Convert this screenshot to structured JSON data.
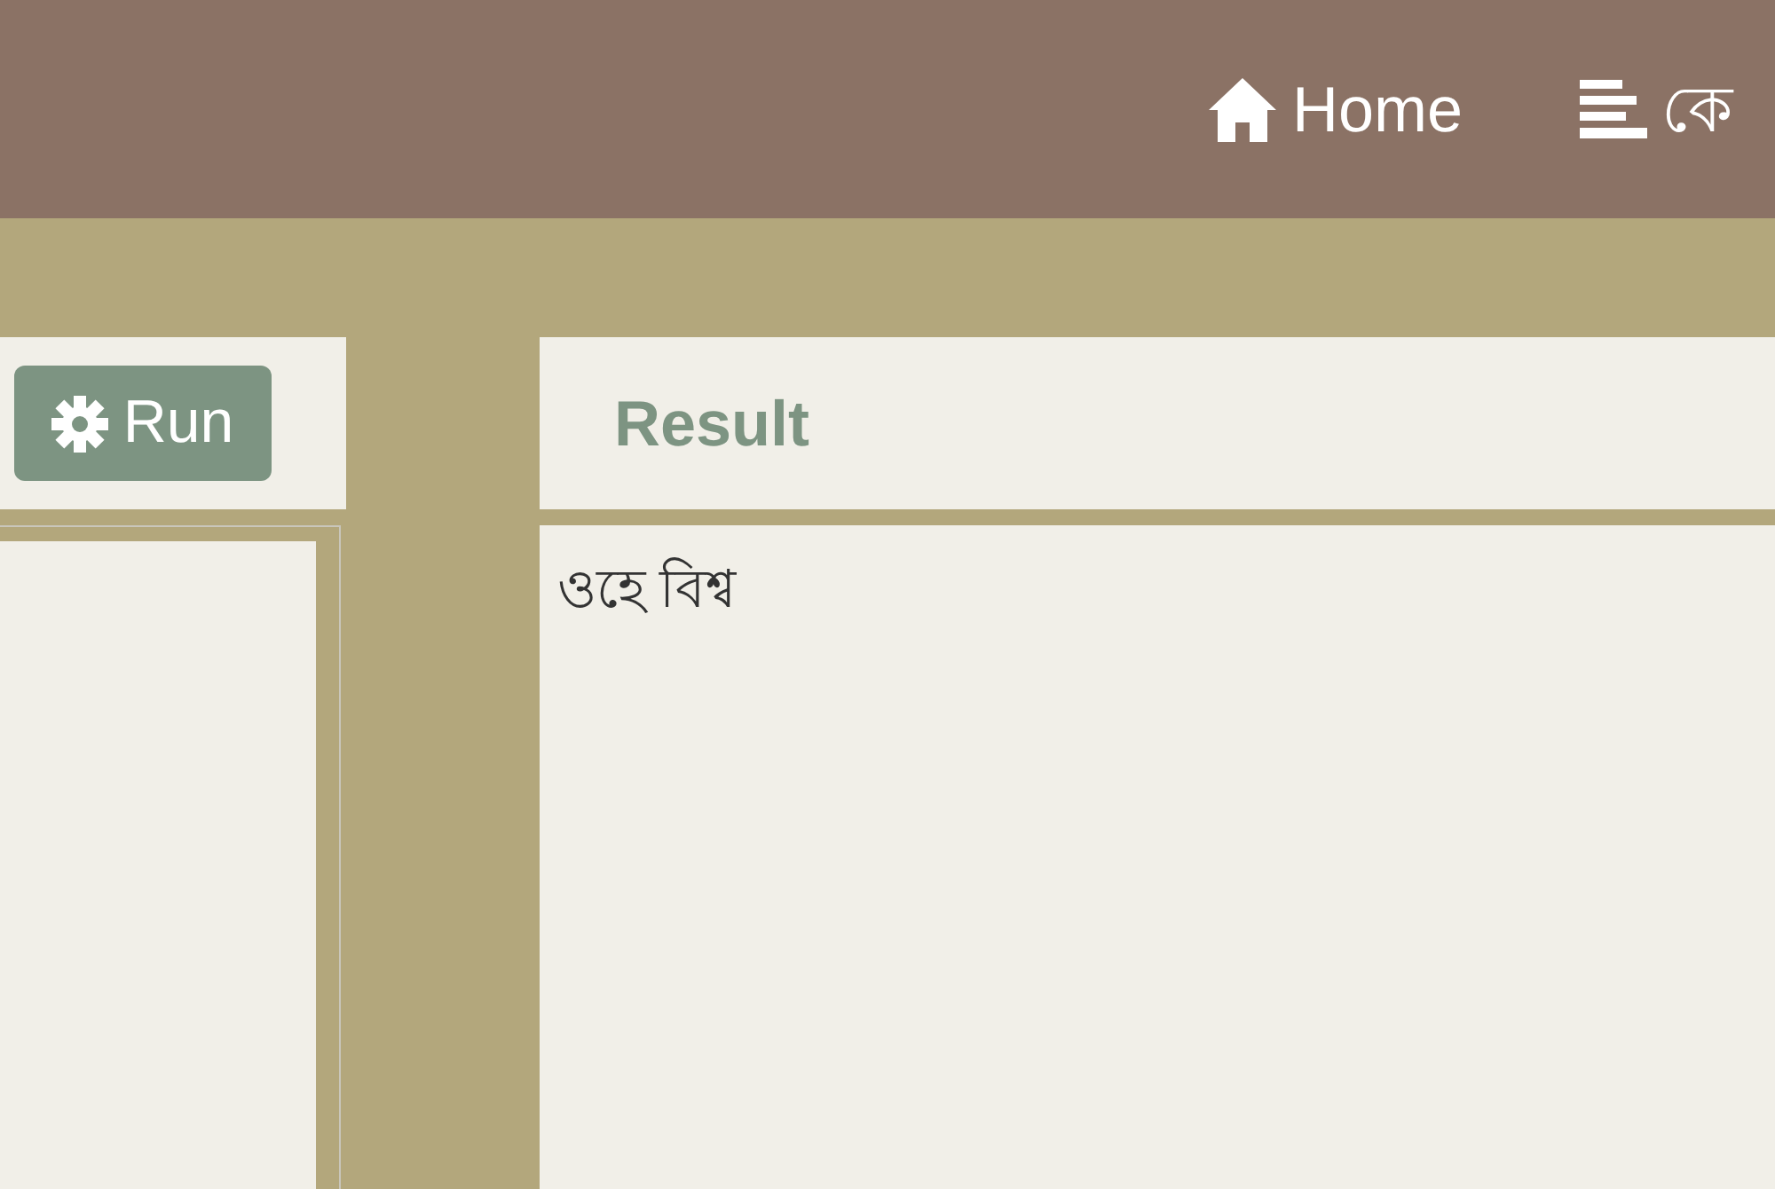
{
  "nav": [
    {
      "kind": "home",
      "label": "Home"
    },
    {
      "kind": "list",
      "label": "কে"
    }
  ],
  "editor": {
    "run_button": "Run"
  },
  "result": {
    "title": "Result",
    "output": "ওহে বিশ্ব"
  }
}
